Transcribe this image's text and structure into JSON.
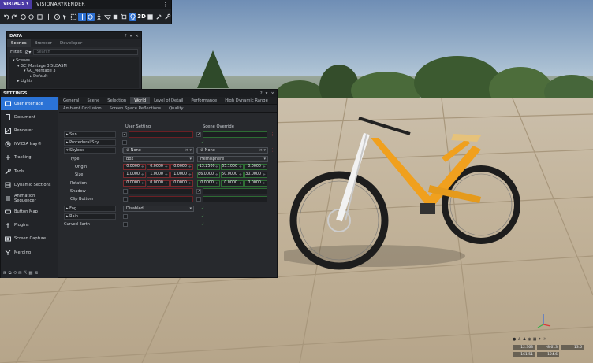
{
  "app": {
    "brand": "VIRTALIS",
    "brand_arrow": "▾",
    "name": "VISIONARYRENDER",
    "menu_icon": "⋮"
  },
  "toolbar": {
    "tools": [
      "undo-icon",
      "redo-icon",
      "reload-icon",
      "refresh-icon",
      "cube-icon",
      "move-icon",
      "scale-icon",
      "select-icon",
      "select-box-icon",
      "walk-icon",
      "view-icon",
      "tablet-icon",
      "cube-rotate-icon",
      "light-icon",
      "3d-label",
      "fullscreen-icon",
      "tools-icon",
      "wrench-icon"
    ],
    "label_3d": "3D"
  },
  "data_panel": {
    "title": "DATA",
    "controls": [
      "?",
      "▾",
      "×"
    ],
    "tabs": [
      "Scenes",
      "Browser",
      "Developer"
    ],
    "filter_label": "Filter:",
    "search_placeholder": "Search",
    "tree": [
      "Scenes",
      "GC_Montage 3.5LDASM",
      "GC_Montage 3",
      "Default",
      "Lights"
    ]
  },
  "settings": {
    "title": "SETTINGS",
    "controls": [
      "?",
      "▾",
      "×"
    ],
    "sidebar": [
      {
        "label": "User Interface",
        "icon": "monitor-icon",
        "active": true
      },
      {
        "label": "Document",
        "icon": "document-icon",
        "active": false
      },
      {
        "label": "Renderer",
        "icon": "renderer-icon",
        "active": false
      },
      {
        "label": "NVIDIA Iray®",
        "icon": "iray-icon",
        "active": false
      },
      {
        "label": "Tracking",
        "icon": "tracking-icon",
        "active": false
      },
      {
        "label": "Tools",
        "icon": "tools-icon",
        "active": false
      },
      {
        "label": "Dynamic Sections",
        "icon": "sections-icon",
        "active": false
      },
      {
        "label": "Animation Sequencer",
        "icon": "sequencer-icon",
        "active": false
      },
      {
        "label": "Button Map",
        "icon": "button-map-icon",
        "active": false
      },
      {
        "label": "Plugins",
        "icon": "plugin-icon",
        "active": false
      },
      {
        "label": "Screen Capture",
        "icon": "camera-icon",
        "active": false
      },
      {
        "label": "Merging",
        "icon": "merge-icon",
        "active": false
      }
    ],
    "tabs": [
      "General",
      "Scene",
      "Selection",
      "World",
      "Level of Detail",
      "Performance",
      "High Dynamic Range"
    ],
    "active_tab": "World",
    "subtabs": [
      "Ambient Occlusion",
      "Screen Space Reflections",
      "Quality"
    ],
    "col_user": "User Setting",
    "col_override": "Scene Override",
    "rows": {
      "sun": "Sun",
      "procedural_sky": "Procedural Sky",
      "skybox": "Skybox",
      "skybox_user_value": "None",
      "skybox_override_value": "None",
      "type": "Type",
      "type_user": "Box",
      "type_override": "Hemisphere",
      "origin": "Origin",
      "origin_user": [
        "0.0000",
        "0.0000",
        "0.0000"
      ],
      "origin_override": [
        "-13.2500",
        "65.1000",
        "0.0000"
      ],
      "size": "Size",
      "size_user": [
        "1.0000",
        "1.0000",
        "1.0000"
      ],
      "size_override": [
        "86.0000",
        "50.0000",
        "30.0000"
      ],
      "rotation": "Rotation",
      "rotation_user": [
        "0.0000",
        "0.0000",
        "0.0000"
      ],
      "rotation_override": [
        "0.0000",
        "0.0000",
        "0.0000"
      ],
      "shadow": "Shadow",
      "clip_bottom": "Clip Bottom",
      "fog": "Fog",
      "fog_value": "Disabled",
      "rain": "Rain",
      "curved_earth": "Curved Earth"
    }
  },
  "stats": {
    "values": [
      "12.363",
      "-8.613",
      "13.6",
      "161.51",
      "124.6"
    ]
  },
  "colors": {
    "accent": "#2b73d6",
    "brand": "#4b3aa5",
    "bike": "#f0a01e"
  }
}
